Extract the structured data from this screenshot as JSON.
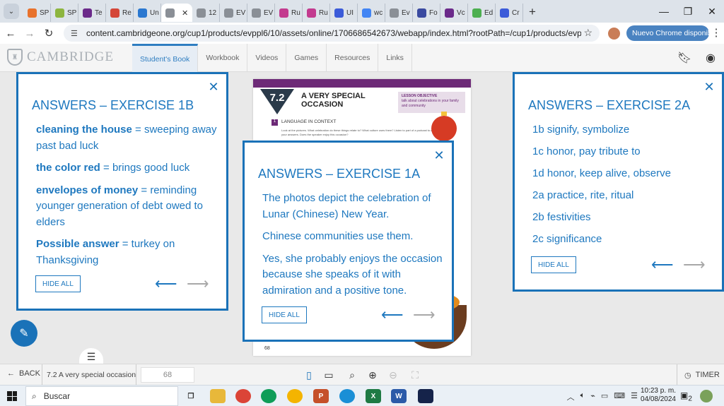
{
  "browser": {
    "tabs": [
      {
        "label": "SP",
        "color": "#e8722c",
        "icon": "sp-favicon"
      },
      {
        "label": "SP",
        "color": "#8db53f",
        "icon": "sp-favicon"
      },
      {
        "label": "Te",
        "color": "#6b2a8a",
        "icon": "teams-favicon"
      },
      {
        "label": "Re",
        "color": "#d44638",
        "icon": "gmail-favicon"
      },
      {
        "label": "Un",
        "color": "#2b78d0",
        "icon": "un-favicon"
      },
      {
        "label": "",
        "color": "#8a8f96",
        "icon": "cambridge-favicon",
        "active": true
      },
      {
        "label": "12",
        "color": "#8a8f96",
        "icon": "globe-favicon"
      },
      {
        "label": "EV",
        "color": "#8a8f96",
        "icon": "globe-favicon"
      },
      {
        "label": "EV",
        "color": "#8a8f96",
        "icon": "globe-favicon"
      },
      {
        "label": "Ru",
        "color": "#c33b8f",
        "icon": "ru-favicon"
      },
      {
        "label": "Ru",
        "color": "#c33b8f",
        "icon": "ru-favicon"
      },
      {
        "label": "UI",
        "color": "#3b5bd9",
        "icon": "search-favicon"
      },
      {
        "label": "wc",
        "color": "#4285f4",
        "icon": "google-favicon"
      },
      {
        "label": "Ev",
        "color": "#8a8f96",
        "icon": "globe-favicon"
      },
      {
        "label": "Fo",
        "color": "#3a4aa0",
        "icon": "forms-favicon"
      },
      {
        "label": "Vc",
        "color": "#6b2a8a",
        "icon": "vocab-favicon"
      },
      {
        "label": "Ed",
        "color": "#4caf50",
        "icon": "ed-favicon"
      },
      {
        "label": "Cr",
        "color": "#3b5bd9",
        "icon": "search-favicon"
      }
    ],
    "url": "content.cambridgeone.org/cup1/products/evppl6/10/assets/online/1706686542673/webapp/index.html?rootPath=/cup1/products/evppl6/10/assets/...",
    "update_label": "Nuevo Chrome disponible"
  },
  "app": {
    "logo": "CAMBRIDGE",
    "nav": [
      "Student's Book",
      "Workbook",
      "Videos",
      "Games",
      "Resources",
      "Links"
    ]
  },
  "page": {
    "number": "7.2",
    "title": "A VERY SPECIAL OCCASION",
    "objective_label": "LESSON OBJECTIVE",
    "objective_text": "talk about celebrations in your family and community",
    "section_num": "1",
    "section": "LANGUAGE IN CONTEXT",
    "instruction": "Look at the pictures. What celebration do these things relate to? What culture uses them? Listen to part of a podcast to check your answers. Does the speaker enjoy this occasion?",
    "folio": "68"
  },
  "panel_left": {
    "title": "ANSWERS – EXERCISE 1B",
    "items": [
      {
        "term": "cleaning the house",
        "def": " = sweeping away past bad luck"
      },
      {
        "term": "the color red",
        "def": " = brings good luck"
      },
      {
        "term": "envelopes of money",
        "def": " = reminding younger generation of debt owed to elders"
      },
      {
        "term": "Possible answer",
        "def": " = turkey on Thanksgiving"
      }
    ],
    "hide_all": "HIDE ALL"
  },
  "panel_center": {
    "title": "ANSWERS – EXERCISE 1A",
    "items": [
      "The photos depict the celebration of Lunar (Chinese) New Year.",
      "Chinese communities use them.",
      "Yes, she probably enjoys the occasion because she speaks of it with admiration and a positive tone."
    ],
    "hide_all": "HIDE ALL"
  },
  "panel_right": {
    "title": "ANSWERS – EXERCISE 2A",
    "items": [
      "1b signify, symbolize",
      "1c honor, pay tribute to",
      "1d honor, keep alive, observe",
      "2a practice, rite, ritual",
      "2b festivities",
      "2c significance"
    ],
    "hide_all": "HIDE ALL"
  },
  "bottom": {
    "back_label": "BACK",
    "page_name": "7.2 A very special occasion",
    "page_input": "68",
    "timer_label": "TIMER"
  },
  "taskbar": {
    "search_label": "Buscar",
    "time": "10:23 p. m.",
    "date": "04/08/2024",
    "notifications": "2"
  },
  "colors": {
    "accent": "#1a72b8",
    "answer_text": "#1e78bf",
    "page_band": "#6d2a77"
  }
}
